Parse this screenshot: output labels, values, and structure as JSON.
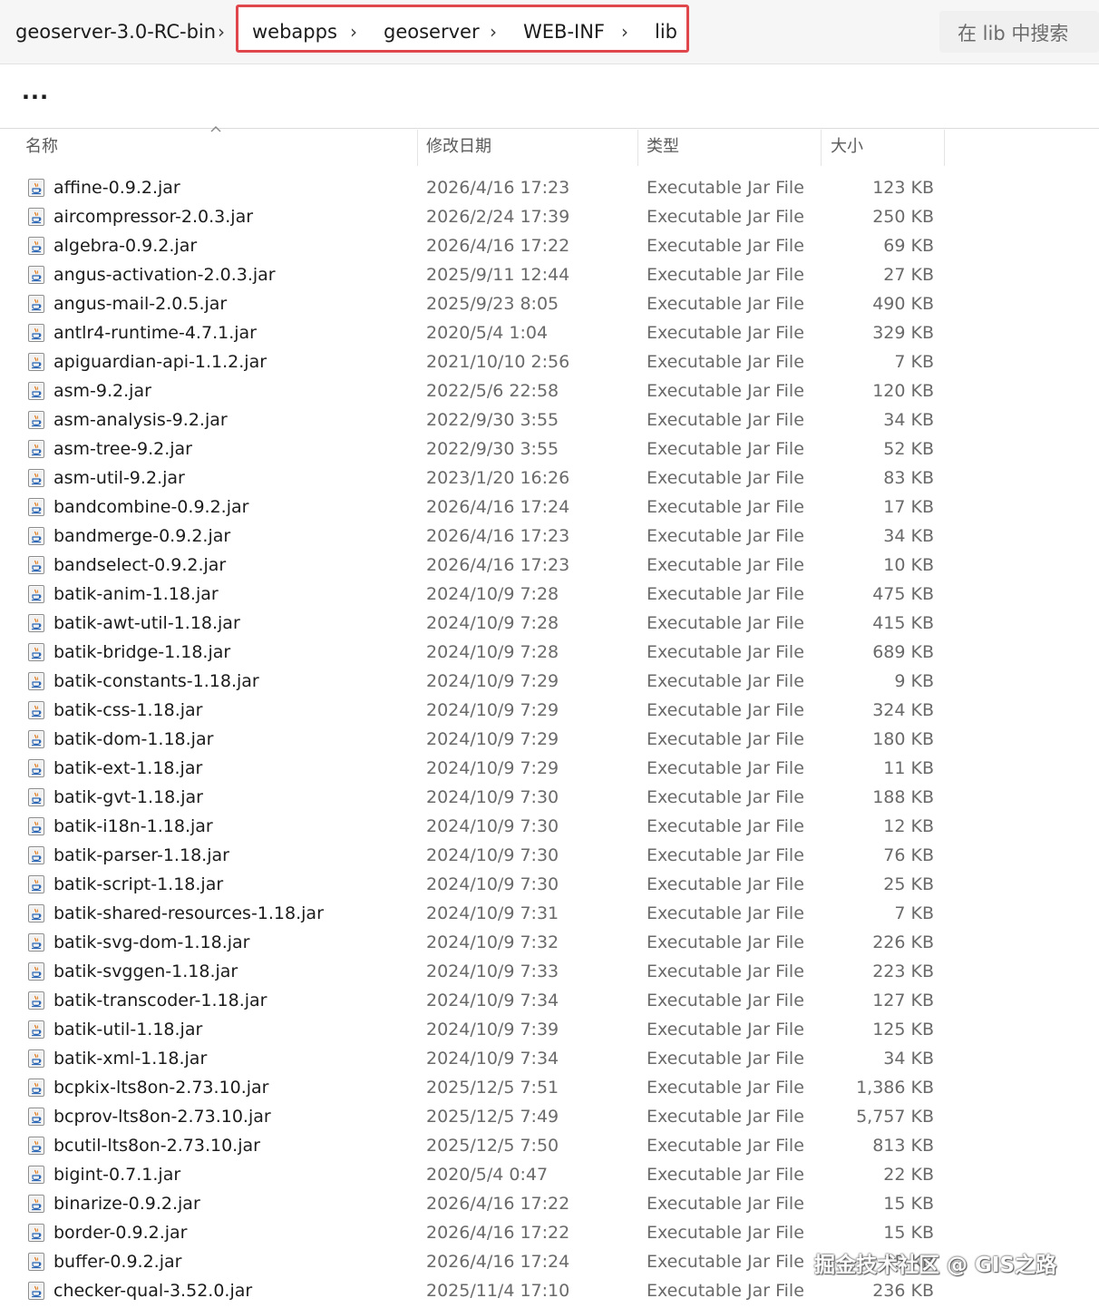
{
  "breadcrumb": {
    "items": [
      "geoserver-3.0-RC-bin",
      "webapps",
      "geoserver",
      "WEB-INF",
      "lib"
    ],
    "separator": "›"
  },
  "search": {
    "placeholder": "在 lib 中搜索"
  },
  "toolbar": {
    "more_label": "..."
  },
  "columns": {
    "name": "名称",
    "date": "修改日期",
    "type": "类型",
    "size": "大小"
  },
  "colors": {
    "highlight": "#e0474c",
    "icon": "java-jar-icon"
  },
  "files": [
    {
      "name": "affine-0.9.2.jar",
      "date": "2026/4/16 17:23",
      "type": "Executable Jar File",
      "size": "123 KB"
    },
    {
      "name": "aircompressor-2.0.3.jar",
      "date": "2026/2/24 17:39",
      "type": "Executable Jar File",
      "size": "250 KB"
    },
    {
      "name": "algebra-0.9.2.jar",
      "date": "2026/4/16 17:22",
      "type": "Executable Jar File",
      "size": "69 KB"
    },
    {
      "name": "angus-activation-2.0.3.jar",
      "date": "2025/9/11 12:44",
      "type": "Executable Jar File",
      "size": "27 KB"
    },
    {
      "name": "angus-mail-2.0.5.jar",
      "date": "2025/9/23 8:05",
      "type": "Executable Jar File",
      "size": "490 KB"
    },
    {
      "name": "antlr4-runtime-4.7.1.jar",
      "date": "2020/5/4 1:04",
      "type": "Executable Jar File",
      "size": "329 KB"
    },
    {
      "name": "apiguardian-api-1.1.2.jar",
      "date": "2021/10/10 2:56",
      "type": "Executable Jar File",
      "size": "7 KB"
    },
    {
      "name": "asm-9.2.jar",
      "date": "2022/5/6 22:58",
      "type": "Executable Jar File",
      "size": "120 KB"
    },
    {
      "name": "asm-analysis-9.2.jar",
      "date": "2022/9/30 3:55",
      "type": "Executable Jar File",
      "size": "34 KB"
    },
    {
      "name": "asm-tree-9.2.jar",
      "date": "2022/9/30 3:55",
      "type": "Executable Jar File",
      "size": "52 KB"
    },
    {
      "name": "asm-util-9.2.jar",
      "date": "2023/1/20 16:26",
      "type": "Executable Jar File",
      "size": "83 KB"
    },
    {
      "name": "bandcombine-0.9.2.jar",
      "date": "2026/4/16 17:24",
      "type": "Executable Jar File",
      "size": "17 KB"
    },
    {
      "name": "bandmerge-0.9.2.jar",
      "date": "2026/4/16 17:23",
      "type": "Executable Jar File",
      "size": "34 KB"
    },
    {
      "name": "bandselect-0.9.2.jar",
      "date": "2026/4/16 17:23",
      "type": "Executable Jar File",
      "size": "10 KB"
    },
    {
      "name": "batik-anim-1.18.jar",
      "date": "2024/10/9 7:28",
      "type": "Executable Jar File",
      "size": "475 KB"
    },
    {
      "name": "batik-awt-util-1.18.jar",
      "date": "2024/10/9 7:28",
      "type": "Executable Jar File",
      "size": "415 KB"
    },
    {
      "name": "batik-bridge-1.18.jar",
      "date": "2024/10/9 7:28",
      "type": "Executable Jar File",
      "size": "689 KB"
    },
    {
      "name": "batik-constants-1.18.jar",
      "date": "2024/10/9 7:29",
      "type": "Executable Jar File",
      "size": "9 KB"
    },
    {
      "name": "batik-css-1.18.jar",
      "date": "2024/10/9 7:29",
      "type": "Executable Jar File",
      "size": "324 KB"
    },
    {
      "name": "batik-dom-1.18.jar",
      "date": "2024/10/9 7:29",
      "type": "Executable Jar File",
      "size": "180 KB"
    },
    {
      "name": "batik-ext-1.18.jar",
      "date": "2024/10/9 7:29",
      "type": "Executable Jar File",
      "size": "11 KB"
    },
    {
      "name": "batik-gvt-1.18.jar",
      "date": "2024/10/9 7:30",
      "type": "Executable Jar File",
      "size": "188 KB"
    },
    {
      "name": "batik-i18n-1.18.jar",
      "date": "2024/10/9 7:30",
      "type": "Executable Jar File",
      "size": "12 KB"
    },
    {
      "name": "batik-parser-1.18.jar",
      "date": "2024/10/9 7:30",
      "type": "Executable Jar File",
      "size": "76 KB"
    },
    {
      "name": "batik-script-1.18.jar",
      "date": "2024/10/9 7:30",
      "type": "Executable Jar File",
      "size": "25 KB"
    },
    {
      "name": "batik-shared-resources-1.18.jar",
      "date": "2024/10/9 7:31",
      "type": "Executable Jar File",
      "size": "7 KB"
    },
    {
      "name": "batik-svg-dom-1.18.jar",
      "date": "2024/10/9 7:32",
      "type": "Executable Jar File",
      "size": "226 KB"
    },
    {
      "name": "batik-svggen-1.18.jar",
      "date": "2024/10/9 7:33",
      "type": "Executable Jar File",
      "size": "223 KB"
    },
    {
      "name": "batik-transcoder-1.18.jar",
      "date": "2024/10/9 7:34",
      "type": "Executable Jar File",
      "size": "127 KB"
    },
    {
      "name": "batik-util-1.18.jar",
      "date": "2024/10/9 7:39",
      "type": "Executable Jar File",
      "size": "125 KB"
    },
    {
      "name": "batik-xml-1.18.jar",
      "date": "2024/10/9 7:34",
      "type": "Executable Jar File",
      "size": "34 KB"
    },
    {
      "name": "bcpkix-lts8on-2.73.10.jar",
      "date": "2025/12/5 7:51",
      "type": "Executable Jar File",
      "size": "1,386 KB"
    },
    {
      "name": "bcprov-lts8on-2.73.10.jar",
      "date": "2025/12/5 7:49",
      "type": "Executable Jar File",
      "size": "5,757 KB"
    },
    {
      "name": "bcutil-lts8on-2.73.10.jar",
      "date": "2025/12/5 7:50",
      "type": "Executable Jar File",
      "size": "813 KB"
    },
    {
      "name": "bigint-0.7.1.jar",
      "date": "2020/5/4 0:47",
      "type": "Executable Jar File",
      "size": "22 KB"
    },
    {
      "name": "binarize-0.9.2.jar",
      "date": "2026/4/16 17:22",
      "type": "Executable Jar File",
      "size": "15 KB"
    },
    {
      "name": "border-0.9.2.jar",
      "date": "2026/4/16 17:22",
      "type": "Executable Jar File",
      "size": "15 KB"
    },
    {
      "name": "buffer-0.9.2.jar",
      "date": "2026/4/16 17:24",
      "type": "Executable Jar File",
      "size": "15 KB"
    },
    {
      "name": "checker-qual-3.52.0.jar",
      "date": "2025/11/4 17:10",
      "type": "Executable Jar File",
      "size": "236 KB"
    }
  ],
  "watermark": "掘金技术社区 @ GIS之路"
}
